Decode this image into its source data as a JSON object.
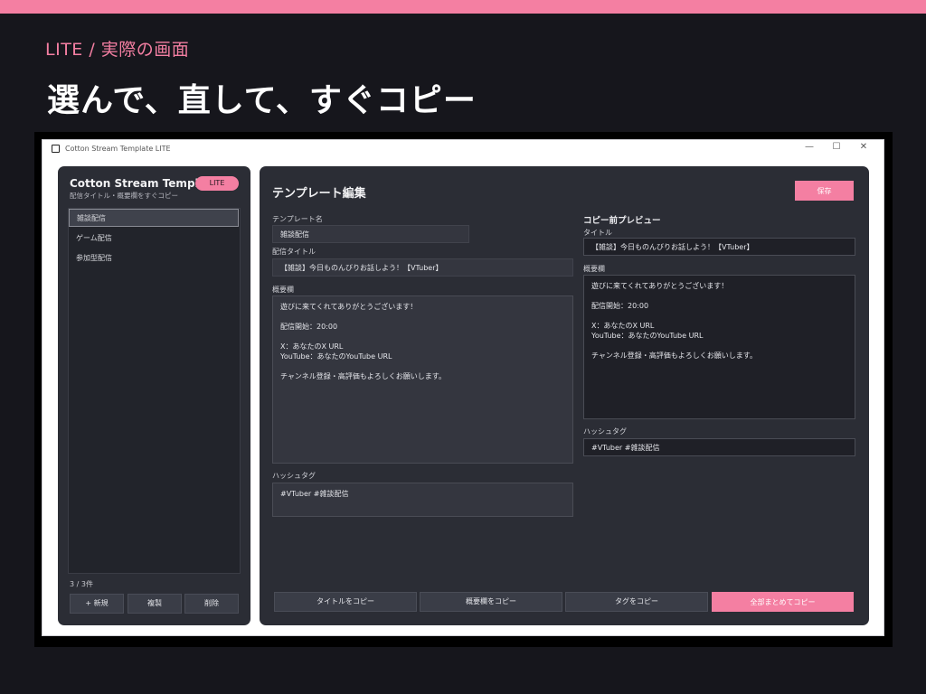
{
  "slide": {
    "kicker": "LITE / 実際の画面",
    "headline": "選んで、直して、すぐコピー"
  },
  "window": {
    "title": "Cotton Stream Template LITE",
    "controls": {
      "minimize": "—",
      "maximize": "☐",
      "close": "✕"
    }
  },
  "sidebar": {
    "app_title": "Cotton Stream Template",
    "badge": "LITE",
    "subtitle": "配信タイトル・概要欄をすぐコピー",
    "items": [
      {
        "label": "雑談配信",
        "selected": true
      },
      {
        "label": "ゲーム配信",
        "selected": false
      },
      {
        "label": "参加型配信",
        "selected": false
      }
    ],
    "count": "3 / 3件",
    "buttons": {
      "new": "+ 新規",
      "duplicate": "複製",
      "delete": "削除"
    }
  },
  "editor": {
    "heading": "テンプレート編集",
    "save": "保存",
    "name_label": "テンプレート名",
    "name_value": "雑談配信",
    "title_label": "配信タイトル",
    "title_value": "【雑談】今日ものんびりお話しよう！【VTuber】",
    "desc_label": "概要欄",
    "desc_lines": [
      "遊びに来てくれてありがとうございます！",
      "",
      "配信開始：20:00",
      "",
      "X：あなたのX URL",
      "YouTube：あなたのYouTube URL",
      "",
      "チャンネル登録・高評価もよろしくお願いします。"
    ],
    "tags_label": "ハッシュタグ",
    "tags_value": "#VTuber #雑談配信"
  },
  "preview": {
    "heading": "コピー前プレビュー",
    "title_label": "タイトル",
    "title_value": "【雑談】今日ものんびりお話しよう！【VTuber】",
    "desc_label": "概要欄",
    "desc_lines": [
      "遊びに来てくれてありがとうございます！",
      "",
      "配信開始：20:00",
      "",
      "X：あなたのX URL",
      "YouTube：あなたのYouTube URL",
      "",
      "チャンネル登録・高評価もよろしくお願いします。"
    ],
    "tags_label": "ハッシュタグ",
    "tags_value": "#VTuber #雑談配信"
  },
  "actions": {
    "copy_title": "タイトルをコピー",
    "copy_desc": "概要欄をコピー",
    "copy_tags": "タグをコピー",
    "copy_all": "全部まとめてコピー"
  },
  "colors": {
    "accent": "#f47fa2",
    "background": "#16161c",
    "panel": "#2b2d35"
  }
}
